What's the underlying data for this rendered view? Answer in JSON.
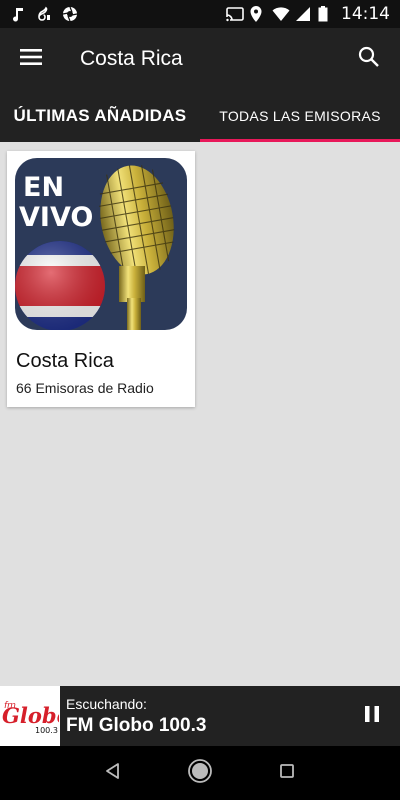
{
  "status_bar": {
    "time": "14:14",
    "left_icons": [
      "music-note-icon",
      "clef-icon",
      "aperture-icon"
    ],
    "right_icons": [
      "cast-icon",
      "location-icon",
      "wifi-icon",
      "signal-icon",
      "battery-icon"
    ]
  },
  "app_bar": {
    "title": "Costa Rica",
    "menu_icon": "hamburger-menu-icon",
    "search_icon": "search-icon"
  },
  "tabs": [
    {
      "label": "ÚLTIMAS AÑADIDAS",
      "active": false
    },
    {
      "label": "TODAS LAS EMISORAS",
      "active": true
    }
  ],
  "accent_color": "#e8195a",
  "cards": [
    {
      "badge": "EN VIVO",
      "title": "Costa Rica",
      "subtitle": "66 Emisoras de Radio"
    }
  ],
  "player": {
    "label": "Escuchando:",
    "station": "FM Globo 100.3",
    "logo": {
      "brand": "Globo",
      "prefix": "fm",
      "freq": "100.3"
    },
    "state": "playing"
  },
  "nav_bar": {
    "back": "back-triangle-icon",
    "home": "home-circle-icon",
    "recents": "recents-square-icon"
  }
}
